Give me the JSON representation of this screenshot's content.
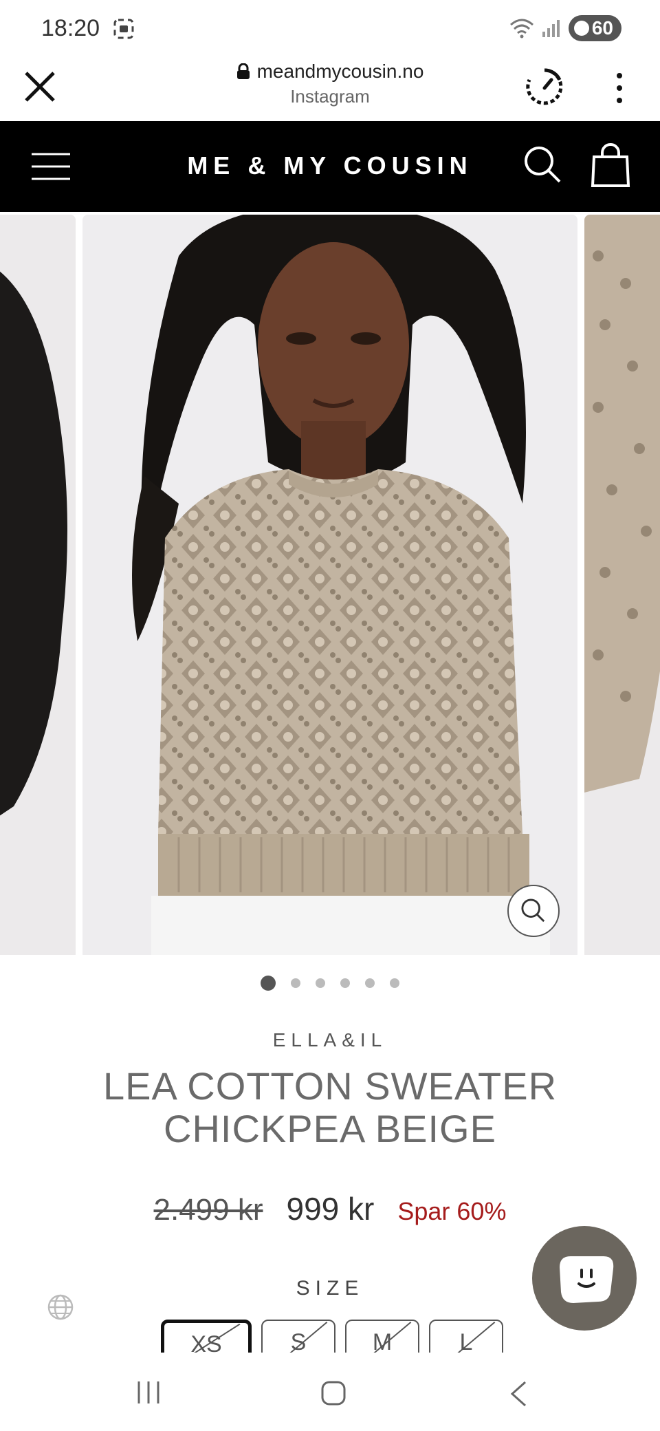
{
  "status_bar": {
    "time": "18:20",
    "battery": "60",
    "icons": [
      "screen-cast-icon",
      "wifi-icon",
      "signal-icon",
      "battery-icon"
    ]
  },
  "browser": {
    "domain": "meandmycousin.no",
    "subtitle": "Instagram",
    "icons": [
      "close-icon",
      "lock-icon",
      "speed-icon",
      "more-icon"
    ]
  },
  "site_header": {
    "logo": "ME & MY COUSIN",
    "icons": [
      "menu-icon",
      "search-icon",
      "cart-icon"
    ],
    "background": "#000000"
  },
  "carousel": {
    "slides": [
      {
        "image": "model side view with long dark hair"
      },
      {
        "image": "model wearing beige crochet knit sweater, front view"
      },
      {
        "image": "sweater sleeve detail"
      }
    ],
    "dot_count": 6,
    "active_index": 0
  },
  "product": {
    "brand": "ELLA&IL",
    "title_line1": "LEA COTTON SWEATER",
    "title_line2": "CHICKPEA BEIGE",
    "old_price": "2.499 kr",
    "new_price": "999 kr",
    "discount": "Spar 60%",
    "discount_color": "#a51c1c",
    "size_label": "SIZE",
    "sizes": [
      "XS",
      "S",
      "M",
      "L"
    ],
    "selected_size": "XS"
  },
  "nav_bar": {
    "icons": [
      "recents-icon",
      "home-icon",
      "back-icon"
    ]
  }
}
